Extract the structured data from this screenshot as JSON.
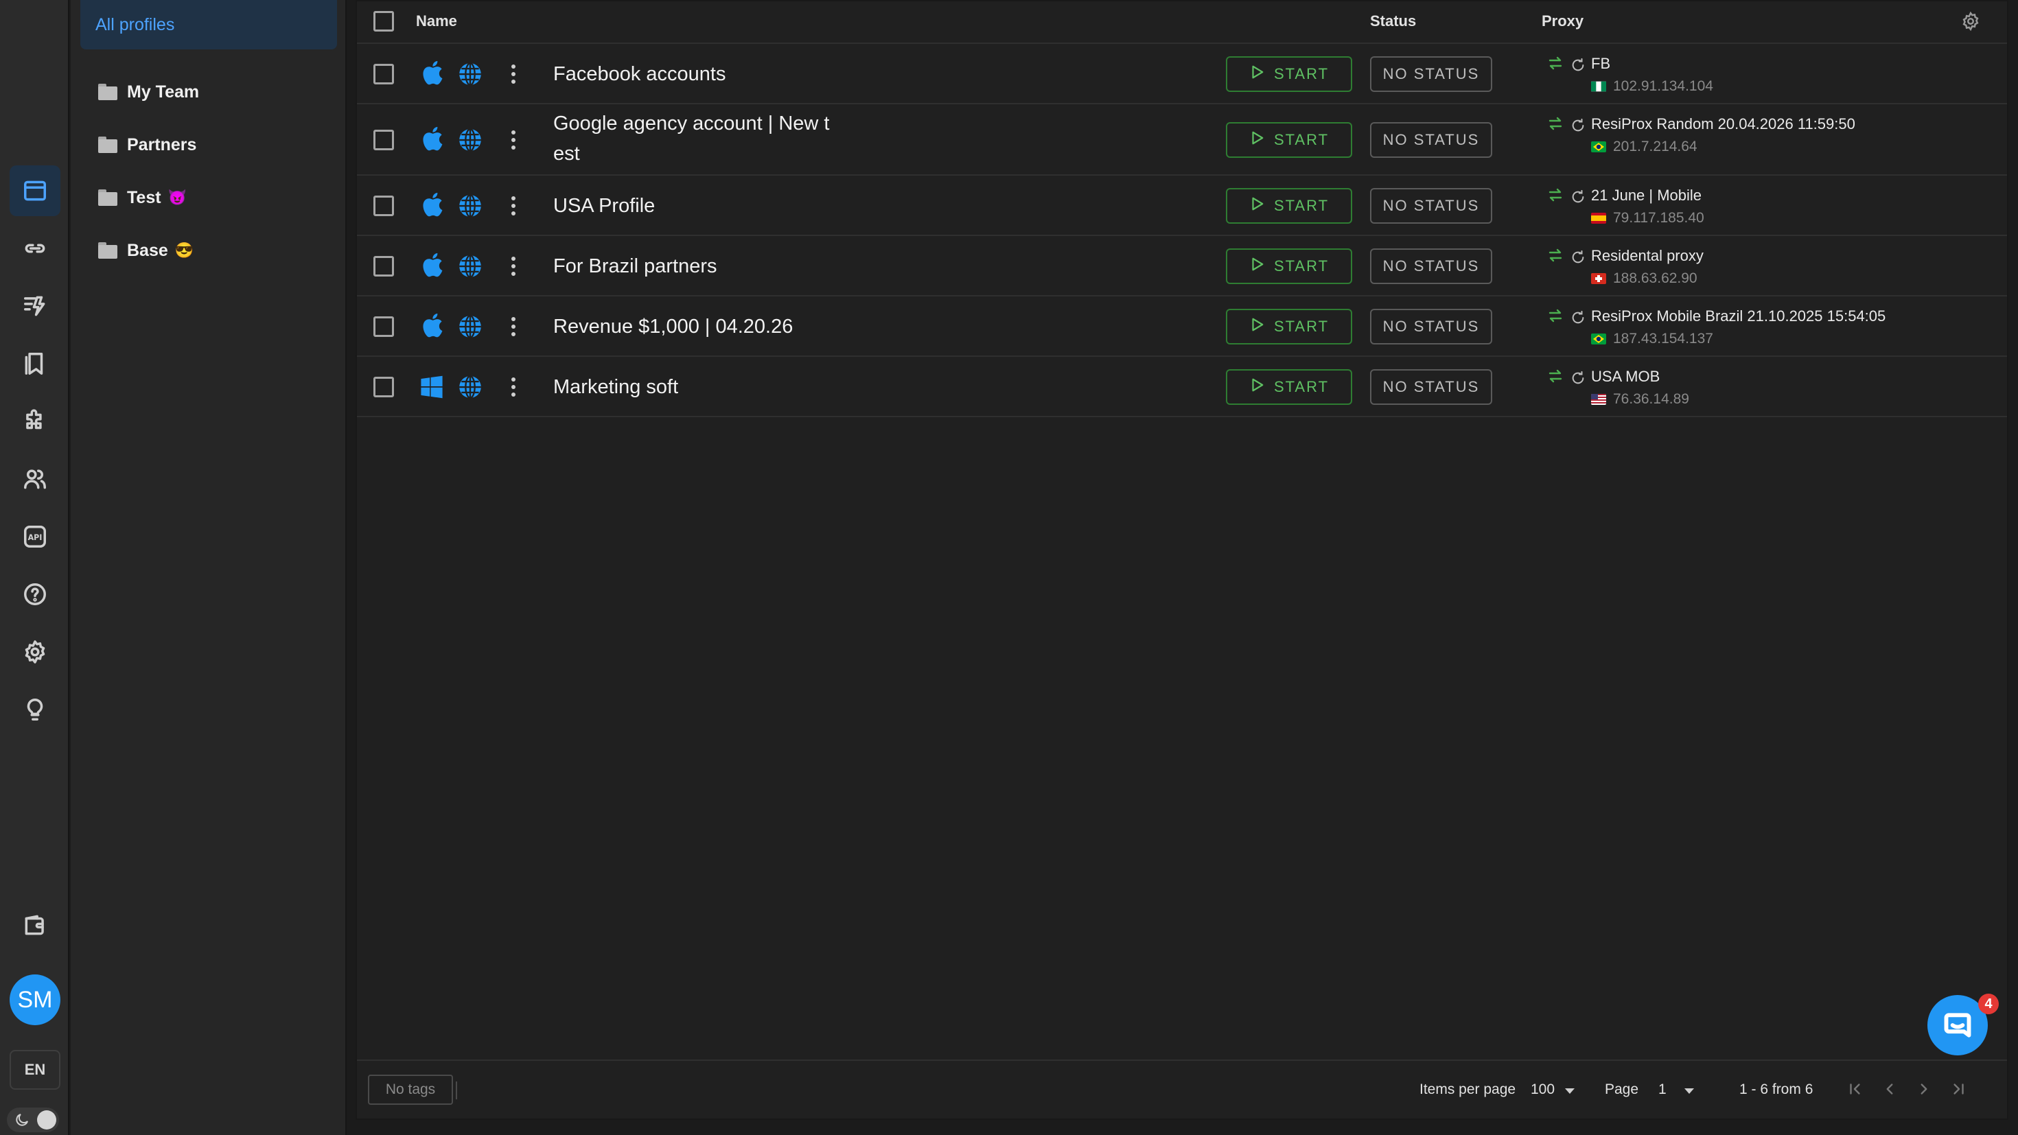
{
  "sidebar": {
    "items": [
      {
        "icon": "browser-window-icon",
        "active": true
      },
      {
        "icon": "link-icon",
        "active": false
      },
      {
        "icon": "automation-icon",
        "active": false
      },
      {
        "icon": "bookmarks-icon",
        "active": false
      },
      {
        "icon": "puzzle-extension-icon",
        "active": false
      },
      {
        "icon": "users-icon",
        "active": false
      },
      {
        "icon": "api-icon",
        "active": false
      },
      {
        "icon": "help-icon",
        "active": false
      },
      {
        "icon": "gear-icon",
        "active": false
      },
      {
        "icon": "lightbulb-icon",
        "active": false
      },
      {
        "icon": "wallet-icon",
        "active": false
      }
    ],
    "avatar_initials": "SM",
    "language": "EN",
    "theme": "dark"
  },
  "folders": {
    "all_label": "All profiles",
    "items": [
      {
        "name": "My Team",
        "emoji": ""
      },
      {
        "name": "Partners",
        "emoji": ""
      },
      {
        "name": "Test",
        "emoji": "😈"
      },
      {
        "name": "Base",
        "emoji": "😎"
      }
    ]
  },
  "table": {
    "columns": {
      "name": "Name",
      "status": "Status",
      "proxy": "Proxy"
    },
    "start_label": "START",
    "status_label": "NO STATUS",
    "rows": [
      {
        "os": "apple-icon",
        "name": "Facebook accounts",
        "proxy_name": "FB",
        "proxy_country": "Nigeria",
        "proxy_ip": "102.91.134.104"
      },
      {
        "os": "apple-icon",
        "name": "Google agency account | New t est",
        "proxy_name": "ResiProx Random 20.04.2026 11:59:50",
        "proxy_country": "Brazil",
        "proxy_ip": "201.7.214.64"
      },
      {
        "os": "apple-icon",
        "name": "USA Profile",
        "proxy_name": "21 June | Mobile",
        "proxy_country": "Spain",
        "proxy_ip": "79.117.185.40"
      },
      {
        "os": "apple-icon",
        "name": "For Brazil partners",
        "proxy_name": "Residental proxy",
        "proxy_country": "Switzerland",
        "proxy_ip": "188.63.62.90"
      },
      {
        "os": "apple-icon",
        "name": "Revenue $1,000 | 04.20.26",
        "proxy_name": "ResiProx Mobile Brazil 21.10.2025 15:54:05",
        "proxy_country": "Brazil",
        "proxy_ip": "187.43.154.137"
      },
      {
        "os": "windows-icon",
        "name": "Marketing soft",
        "proxy_name": "USA MOB",
        "proxy_country": "USA",
        "proxy_ip": "76.36.14.89"
      }
    ]
  },
  "footer": {
    "tags_label": "No tags",
    "items_per_page_label": "Items per page",
    "items_per_page_value": "100",
    "page_label": "Page",
    "page_value": "1",
    "range_text": "1 - 6 from 6"
  },
  "chat": {
    "badge_count": "4"
  },
  "colors": {
    "accent": "#2196f3",
    "start_green": "#5fc163",
    "swap_green": "#4caf50"
  }
}
